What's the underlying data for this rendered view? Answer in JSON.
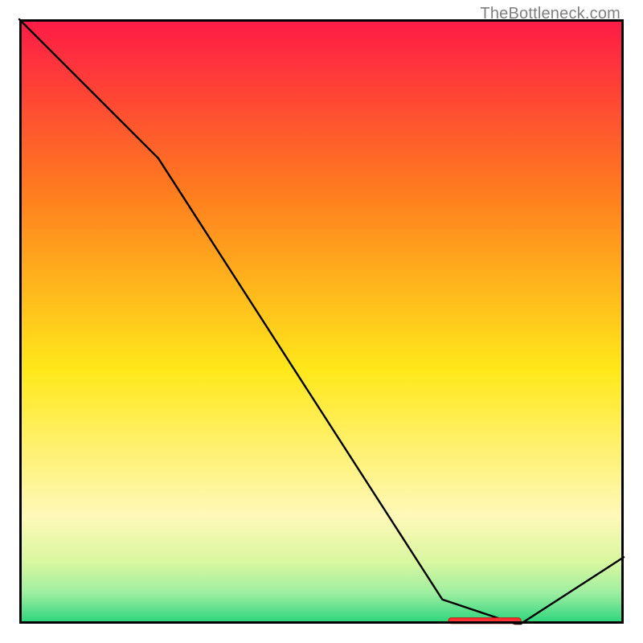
{
  "attribution": "TheBottleneck.com",
  "colors": {
    "line": "#000000",
    "marker_fill": "#fa3232",
    "marker_stroke": "#c81414",
    "border": "#000000",
    "gradient_top": "#ff1a47",
    "gradient_upper": "#ff7a1f",
    "gradient_mid": "#ffe81a",
    "gradient_low": "#fff8b8",
    "gradient_band_a": "#d7f7a0",
    "gradient_band_b": "#9ceea0",
    "gradient_bottom": "#28d47a",
    "attribution_text": "#7f7f7f"
  },
  "chart_data": {
    "type": "line",
    "x": [
      0.0,
      0.22,
      0.23,
      0.7,
      0.82,
      0.83,
      1.0
    ],
    "values": [
      1.0,
      0.78,
      0.77,
      0.04,
      0.0,
      0.0,
      0.11
    ],
    "xlim": [
      0,
      1
    ],
    "ylim": [
      0,
      1
    ],
    "xlabel": "",
    "ylabel": "",
    "title": "",
    "optimum_marker": {
      "x_range": [
        0.71,
        0.83
      ],
      "y": 0.005
    }
  }
}
